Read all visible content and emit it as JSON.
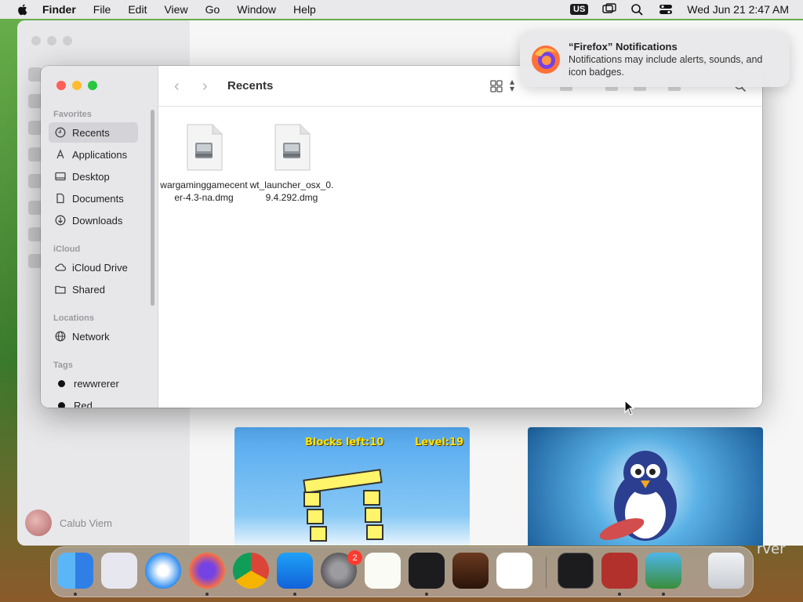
{
  "menubar": {
    "app_name": "Finder",
    "menus": [
      "File",
      "Edit",
      "View",
      "Go",
      "Window",
      "Help"
    ],
    "input_source": "US",
    "datetime": "Wed Jun 21  2:47 AM"
  },
  "background_window": {
    "user_name": "Calub Viem",
    "card1_blocks": "Blocks left:10",
    "card1_level": "Level:19"
  },
  "finder": {
    "title": "Recents",
    "sidebar": {
      "favorites_header": "Favorites",
      "favorites": [
        {
          "label": "Recents",
          "icon": "clock-icon"
        },
        {
          "label": "Applications",
          "icon": "applications-icon"
        },
        {
          "label": "Desktop",
          "icon": "desktop-icon"
        },
        {
          "label": "Documents",
          "icon": "document-icon"
        },
        {
          "label": "Downloads",
          "icon": "download-icon"
        }
      ],
      "icloud_header": "iCloud",
      "icloud": [
        {
          "label": "iCloud Drive",
          "icon": "cloud-icon"
        },
        {
          "label": "Shared",
          "icon": "shared-folder-icon"
        }
      ],
      "locations_header": "Locations",
      "locations": [
        {
          "label": "Network",
          "icon": "globe-icon"
        }
      ],
      "tags_header": "Tags",
      "tags": [
        {
          "label": "rewwrerer",
          "color": "#111111"
        },
        {
          "label": "Red",
          "color": "#111111"
        }
      ]
    },
    "files": [
      {
        "name": "wargaminggamecenter-4.3-na.dmg"
      },
      {
        "name": "wt_launcher_osx_0.9.4.292.dmg"
      }
    ]
  },
  "notification": {
    "title": "“Firefox” Notifications",
    "body": "Notifications may include alerts, sounds, and icon badges."
  },
  "dock": {
    "settings_badge": "2",
    "apps": [
      "Finder",
      "Launchpad",
      "Safari",
      "Firefox",
      "Chrome",
      "App Store",
      "System Settings",
      "TextEdit",
      "Terminal",
      "GarageBand",
      "Visual Studio Code",
      "exec",
      "Dictionary",
      "Game",
      "Trash"
    ]
  },
  "background_text": "rver"
}
